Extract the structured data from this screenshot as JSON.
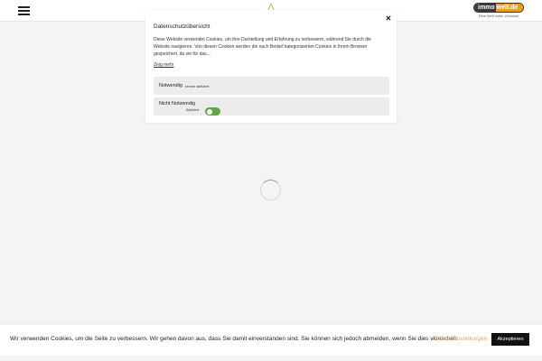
{
  "header": {
    "menu_icon": "hamburger-menu-icon",
    "center_logo_icon": "caret-up-logo-icon",
    "brand": {
      "name_part1": "immo",
      "name_part2": "welt.de",
      "tagline": "Eine Welt voller Zuhause",
      "colors": {
        "dark": "#3a3a3a",
        "accent": "#e4a21c"
      }
    }
  },
  "privacy_modal": {
    "title": "Datenschutzübersicht",
    "close_icon": "close-icon",
    "description": "Diese Website verwendet Cookies, um Ihre Darstellung und Erfahrung zu verbessern, während Sie durch die Website navigieren. Von diesen Cookies werden die nach Bedarf kategorisierten Cookies in Ihrem Browser gespeichert, da sie für das...",
    "read_more": "Zeig mehr",
    "categories": [
      {
        "title": "Notwendig",
        "note": "Immer aktiviert"
      },
      {
        "title": "Nicht Notwendig",
        "note": "Aktiviert",
        "toggle_on": true
      }
    ],
    "toggle_color": "#5ea44a"
  },
  "loading": {
    "icon": "loading-spinner-icon"
  },
  "cookie_bar": {
    "message": "Wir verwenden Cookies, um die Seite zu verbessern. Wir gehen davon aus, dass Sie damit einverstanden sind. Sie können sich jedoch abmelden, wenn Sie dies wünschen.",
    "settings_label": "Cookie Einstellungen",
    "accept_label": "Akzeptieren",
    "settings_color": "#d9aa55"
  }
}
